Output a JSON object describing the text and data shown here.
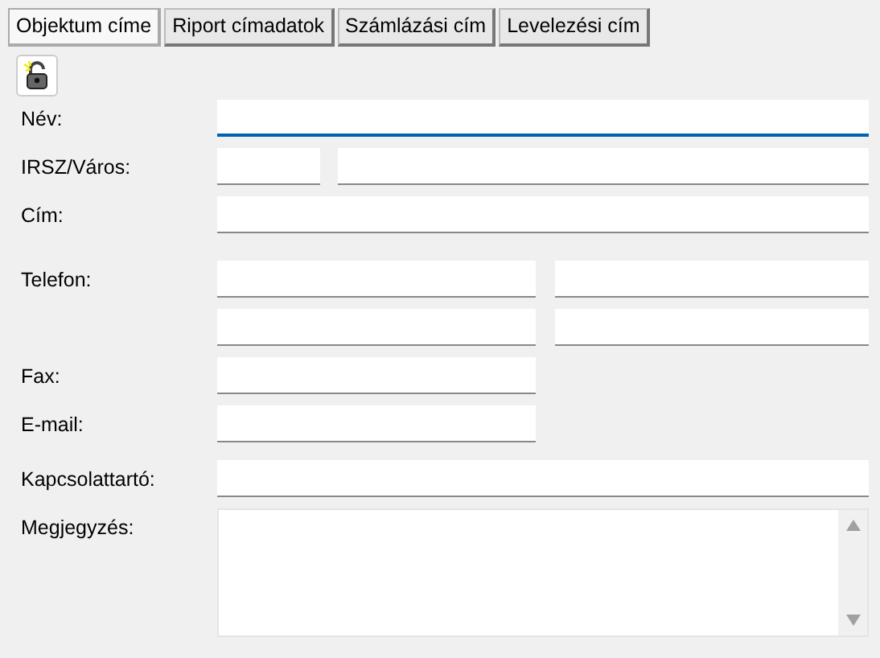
{
  "tabs": [
    {
      "label": "Objektum címe",
      "selected": true
    },
    {
      "label": "Riport címadatok",
      "selected": false
    },
    {
      "label": "Számlázási cím",
      "selected": false
    },
    {
      "label": "Levelezési cím",
      "selected": false
    }
  ],
  "rows": [
    {
      "label": "Név:",
      "kind": "full",
      "focused": true
    },
    {
      "label": "IRSZ/Város:",
      "kind": "zip-city",
      "focused": false
    },
    {
      "label": "Cím:",
      "kind": "full",
      "focused": false
    },
    {
      "label": "Telefon:",
      "kind": "pair",
      "focused": false
    },
    {
      "kind": "pair",
      "focused": false
    },
    {
      "label": "Fax:",
      "kind": "half",
      "focused": false
    },
    {
      "label": "E-mail:",
      "kind": "half",
      "focused": false
    },
    {
      "label": "Kapcsolattartó:",
      "kind": "full",
      "focused": false
    },
    {
      "label": "Megjegyzés:",
      "kind": "memo",
      "focused": false
    }
  ]
}
